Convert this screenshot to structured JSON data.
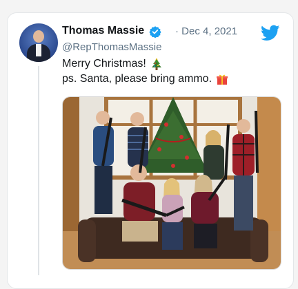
{
  "tweet": {
    "author_name": "Thomas Massie",
    "handle": "@RepThomasMassie",
    "date_separator": "·",
    "date": "Dec 4, 2021",
    "text_line1": "Merry Christmas!",
    "text_line2": "ps. Santa, please bring ammo.",
    "verified": true,
    "icons": {
      "verified": "verified-badge-icon",
      "platform": "twitter-bird-icon",
      "line1_emoji": "christmas-tree-emoji",
      "line2_emoji": "gift-emoji"
    }
  },
  "colors": {
    "accent": "#1da1f2",
    "text": "#14171a",
    "muted": "#5b7083"
  }
}
